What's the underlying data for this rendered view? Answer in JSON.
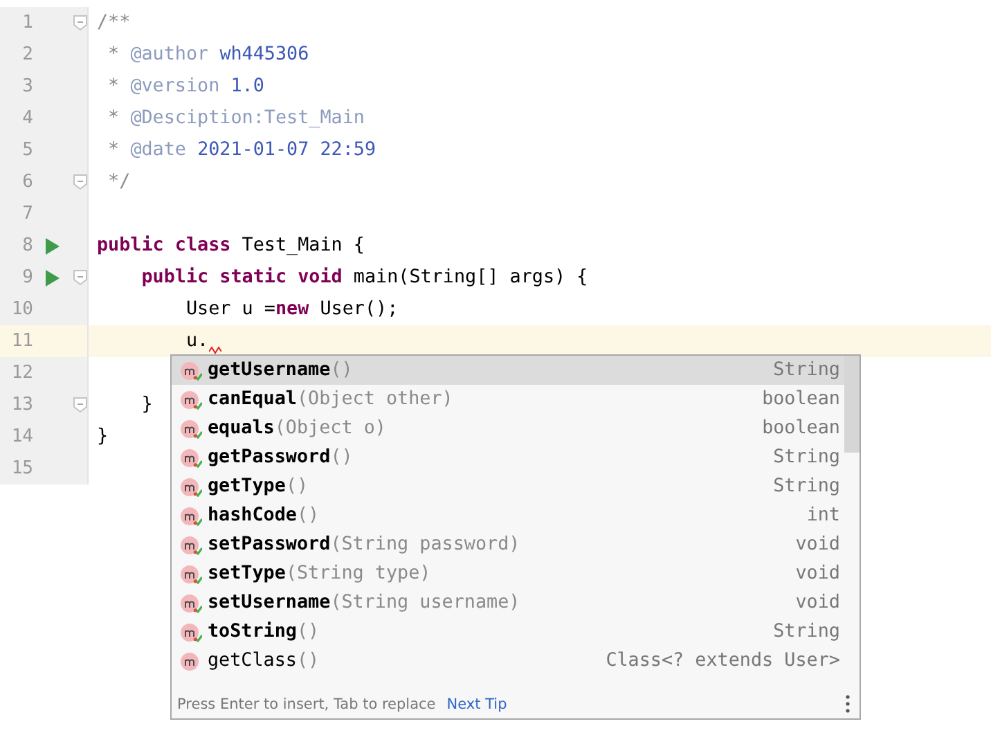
{
  "editor": {
    "lines": [
      {
        "number": "1",
        "fold": true,
        "run": false,
        "current": false,
        "error": false,
        "tokens": [
          {
            "kind": "comment",
            "text": "/**"
          }
        ]
      },
      {
        "number": "2",
        "fold": false,
        "run": false,
        "current": false,
        "error": false,
        "tokens": [
          {
            "kind": "comment",
            "text": " * "
          },
          {
            "kind": "tag",
            "text": "@author "
          },
          {
            "kind": "value",
            "text": "wh445306"
          }
        ]
      },
      {
        "number": "3",
        "fold": false,
        "run": false,
        "current": false,
        "error": false,
        "tokens": [
          {
            "kind": "comment",
            "text": " * "
          },
          {
            "kind": "tag",
            "text": "@version "
          },
          {
            "kind": "value",
            "text": "1.0"
          }
        ]
      },
      {
        "number": "4",
        "fold": false,
        "run": false,
        "current": false,
        "error": false,
        "tokens": [
          {
            "kind": "comment",
            "text": " * "
          },
          {
            "kind": "tag",
            "text": "@Desciption:Test_Main"
          }
        ]
      },
      {
        "number": "5",
        "fold": false,
        "run": false,
        "current": false,
        "error": false,
        "tokens": [
          {
            "kind": "comment",
            "text": " * "
          },
          {
            "kind": "tag",
            "text": "@date "
          },
          {
            "kind": "value",
            "text": "2021-01-07 22:59"
          }
        ]
      },
      {
        "number": "6",
        "fold": true,
        "run": false,
        "current": false,
        "error": false,
        "tokens": [
          {
            "kind": "comment",
            "text": " */"
          }
        ]
      },
      {
        "number": "7",
        "fold": false,
        "run": false,
        "current": false,
        "error": false
      },
      {
        "number": "8",
        "fold": false,
        "run": true,
        "current": false,
        "error": false,
        "tokens": [
          {
            "kind": "keyword",
            "text": "public class"
          },
          {
            "kind": "plain",
            "text": " Test_Main {"
          }
        ]
      },
      {
        "number": "9",
        "fold": true,
        "run": true,
        "current": false,
        "error": false,
        "tokens": [
          {
            "kind": "keyword",
            "text": "    public static void"
          },
          {
            "kind": "plain",
            "text": " main(String[] args) {"
          }
        ]
      },
      {
        "number": "10",
        "fold": false,
        "run": false,
        "current": false,
        "error": false,
        "tokens": [
          {
            "kind": "plain",
            "text": "        User u ="
          },
          {
            "kind": "keyword",
            "text": "new"
          },
          {
            "kind": "plain",
            "text": " User();"
          }
        ]
      },
      {
        "number": "11",
        "fold": false,
        "run": false,
        "current": true,
        "error": true,
        "tokens": [
          {
            "kind": "plain",
            "text": "        u."
          }
        ]
      },
      {
        "number": "12",
        "fold": false,
        "run": false,
        "current": false,
        "error": false
      },
      {
        "number": "13",
        "fold": true,
        "run": false,
        "current": false,
        "error": false,
        "tokens": [
          {
            "kind": "plain",
            "text": "    }"
          }
        ]
      },
      {
        "number": "14",
        "fold": false,
        "run": false,
        "current": false,
        "error": false,
        "tokens": [
          {
            "kind": "plain",
            "text": "}"
          }
        ]
      },
      {
        "number": "15",
        "fold": false,
        "run": false,
        "current": false,
        "error": false
      }
    ]
  },
  "completion": {
    "items": [
      {
        "name": "getUsername",
        "params": "()",
        "type": "String",
        "own": true,
        "selected": true
      },
      {
        "name": "canEqual",
        "params": "(Object other)",
        "type": "boolean",
        "own": true,
        "selected": false
      },
      {
        "name": "equals",
        "params": "(Object o)",
        "type": "boolean",
        "own": true,
        "selected": false
      },
      {
        "name": "getPassword",
        "params": "()",
        "type": "String",
        "own": true,
        "selected": false
      },
      {
        "name": "getType",
        "params": "()",
        "type": "String",
        "own": true,
        "selected": false
      },
      {
        "name": "hashCode",
        "params": "()",
        "type": "int",
        "own": true,
        "selected": false
      },
      {
        "name": "setPassword",
        "params": "(String password)",
        "type": "void",
        "own": true,
        "selected": false
      },
      {
        "name": "setType",
        "params": "(String type)",
        "type": "void",
        "own": true,
        "selected": false
      },
      {
        "name": "setUsername",
        "params": "(String username)",
        "type": "void",
        "own": true,
        "selected": false
      },
      {
        "name": "toString",
        "params": "()",
        "type": "String",
        "own": true,
        "selected": false
      },
      {
        "name": "getClass",
        "params": "()",
        "type": "Class<? extends User>",
        "own": false,
        "selected": false
      }
    ],
    "hint": "Press Enter to insert, Tab to replace",
    "next_tip": "Next Tip"
  }
}
